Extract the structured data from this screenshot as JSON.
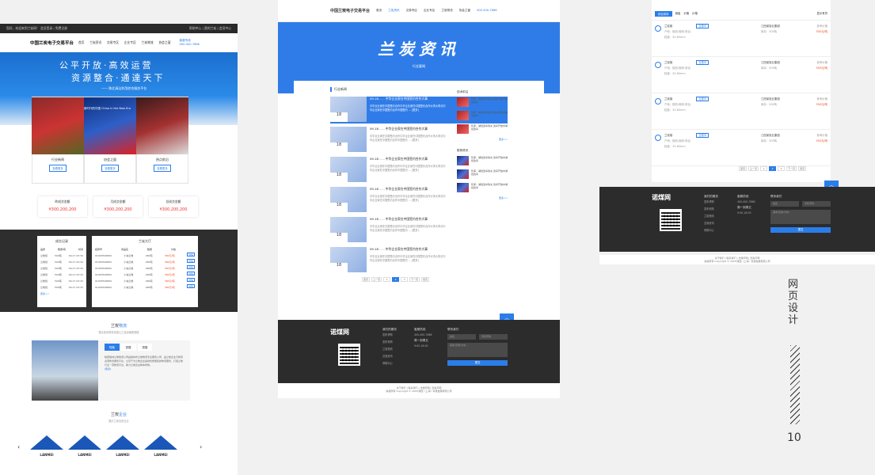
{
  "brand": "中国兰炭电子交易平台",
  "topbar": {
    "left": "您好，欢迎来到兰炭网！  会员登录 | 免费注册",
    "right": "帮助中心 | 我的兰炭 | 会员中心"
  },
  "nav": [
    "首页",
    "兰炭资讯",
    "交易专区",
    "企业专区",
    "兰炭物流",
    "协会之窗"
  ],
  "hotline": {
    "label": "客服专线",
    "number": "400-400-7866"
  },
  "banner": {
    "line1": "公平开放·高效运营",
    "line2": "资源整合·通達天下",
    "line3": "—— 陕北清洁利用综合服务平台"
  },
  "cards": [
    {
      "label": "行业新闻",
      "btn": "查看更多"
    },
    {
      "label": "协会之窗",
      "btn": "查看更多"
    },
    {
      "label": "热点前沿",
      "btn": "查看更多"
    }
  ],
  "card_banner_text": "新时代的中国 China in the New Era",
  "stats": [
    {
      "label": "昨成交金额",
      "value": "¥300,200,200"
    },
    {
      "label": "月成交金额",
      "value": "¥300,200,200"
    },
    {
      "label": "总成交金额",
      "value": "¥300,200,200"
    }
  ],
  "deals": {
    "title": "成交记录",
    "cols": [
      "品牌",
      "数量/吨",
      "时间"
    ],
    "rows": [
      [
        "兰炭煤",
        "500吨",
        "09-17 03:32"
      ],
      [
        "兰炭煤",
        "500吨",
        "09-17 03:32"
      ],
      [
        "兰炭煤",
        "500吨",
        "09-17 03:32"
      ],
      [
        "兰炭煤",
        "500吨",
        "09-17 03:32"
      ],
      [
        "兰炭煤",
        "500吨",
        "09-17 03:32"
      ],
      [
        "兰炭煤",
        "500吨",
        "09-17 03:32"
      ]
    ],
    "more": "更多>>"
  },
  "hall": {
    "title": "兰炭大厅",
    "cols": [
      "挂牌号",
      "商品名",
      "数量",
      "价格"
    ],
    "rows": [
      [
        "01903526800",
        "小块兰炭",
        "260吨",
        "380元/吨"
      ],
      [
        "01903526800",
        "小块兰炭",
        "260吨",
        "380元/吨"
      ],
      [
        "01903526800",
        "小块兰炭",
        "260吨",
        "380元/吨"
      ],
      [
        "01903526800",
        "小块兰炭",
        "260吨",
        "380元/吨"
      ],
      [
        "01903526800",
        "小块兰炭",
        "260吨",
        "380元/吨"
      ],
      [
        "01903526800",
        "小块兰炭",
        "260吨",
        "380元/吨"
      ]
    ],
    "btn": "详情"
  },
  "logistics": {
    "title_a": "兰炭",
    "title_b": "物流",
    "sub": "整合各地物流资源让兰炭运输更便捷",
    "tabs": [
      "陆路",
      "铁路",
      "铁路"
    ],
    "text": "陕西榆林兰炭物流公司是榆林市兰炭物流专业服务公司，是兰炭企业与物流资源整合服务平台，立足于为兰炭企业提供优质便捷的物流服务，打造兰炭行业一流物流平台，助力兰炭企业降本增效。",
    "more": "[更多]"
  },
  "enterprise": {
    "title_a": "兰炭",
    "title_b": "企业",
    "sub": "展示兰炭优质企业",
    "logo_word": "LANMEI"
  },
  "center": {
    "hero": "兰炭资讯",
    "hero_sub": "行业要闻",
    "section": "行业新闻",
    "news_title": "09.18 - - - 中华企业家在中国签约合作大事",
    "news_desc": "中华企业家在中国签约合作中华企业家在中国签约合作大事大事记中华企业家在中国签约合作中国签约 ... [更多]",
    "date_day": "18",
    "date_month": "2018-09",
    "side1": "技术前沿",
    "side2": "推荐资讯",
    "side_text": "售库：湖批改革攻关 改革开放中湖批改革",
    "more": "更多>>",
    "pager": [
      "首页",
      "上一页",
      "1",
      "2",
      "3",
      "下一页",
      "尾页"
    ]
  },
  "footer": {
    "logo": "诺煤网",
    "col1": "我们的服务",
    "col1_items": [
      "发布求购",
      "发布采购",
      "兰炭物流",
      "交易资讯",
      "帮助中心"
    ],
    "col2": "客服热线",
    "phone": "400-400-7866",
    "weekday": "周一到周五",
    "hours": "9:00-18:00",
    "col3": "联系我们",
    "f_name": "姓名",
    "f_phone": "手机号码",
    "f_msg": "需求/咨询/方向...",
    "submit": "提交",
    "links": "关于我们 | 联系我们 | 法律声明 | 隐私声明",
    "copy": "版权所有 Copyright © 2018 陕西（上海）科技发展有限公司"
  },
  "right": {
    "filters": [
      "综合排序",
      "销量",
      "价格",
      "价格"
    ],
    "toggle": "显示有货",
    "list_price": "550元/吨",
    "list_tag": "交易中",
    "list_name": "兰炭煤",
    "origin": "产地：陕西-榆林-府谷",
    "size": "粒度：30-80mm",
    "company": "江西某炭业集团",
    "amount": "库存：500吨",
    "list_label": "参考价格"
  },
  "side_title": "网页设计",
  "page_num": "10"
}
